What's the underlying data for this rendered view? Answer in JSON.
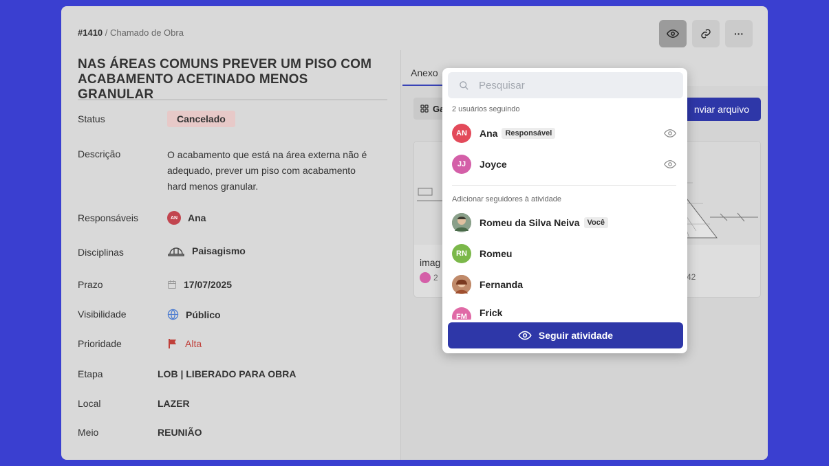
{
  "header": {
    "ticket_number": "#1410",
    "breadcrumb_rest": " / Chamado de Obra",
    "title": "NAS ÁREAS COMUNS PREVER UM PISO COM ACABAMENTO ACETINADO MENOS GRANULAR",
    "more_label": "···"
  },
  "fields": {
    "status": {
      "label": "Status",
      "value": "Cancelado"
    },
    "description": {
      "label": "Descrição",
      "value": "O acabamento que está na área externa não é adequado, prever um piso com acabamento hard menos granular."
    },
    "responsibles": {
      "label": "Responsáveis",
      "value": "Ana",
      "avatar": "AN"
    },
    "disciplines": {
      "label": "Disciplinas",
      "value": "Paisagismo"
    },
    "deadline": {
      "label": "Prazo",
      "value": "17/07/2025"
    },
    "visibility": {
      "label": "Visibilidade",
      "value": "Público"
    },
    "priority": {
      "label": "Prioridade",
      "value": "Alta"
    },
    "stage": {
      "label": "Etapa",
      "value": "LOB | LIBERADO PARA OBRA"
    },
    "location": {
      "label": "Local",
      "value": "LAZER"
    },
    "medium": {
      "label": "Meio",
      "value": "REUNIÃO"
    }
  },
  "attachments": {
    "tab_label": "Anexo",
    "gallery_label": "Ga",
    "send_label": "nviar arquivo",
    "card_name": "imag",
    "card_meta_left": "2",
    "card_meta_right": "42"
  },
  "followers_popup": {
    "search_placeholder": "Pesquisar",
    "following_label": "2 usuários seguindo",
    "following": [
      {
        "initials": "AN",
        "name": "Ana",
        "tag": "Responsável",
        "color": "#e34a5a"
      },
      {
        "initials": "JJ",
        "name": "Joyce",
        "tag": "",
        "color": "#d45fa8"
      }
    ],
    "add_label": "Adicionar seguidores à atividade",
    "candidates": [
      {
        "initials": "",
        "name": "Romeu da Silva Neiva",
        "tag": "Você",
        "color": "#5b7a5a"
      },
      {
        "initials": "RN",
        "name": "Romeu",
        "tag": "",
        "color": "#7bb84a"
      },
      {
        "initials": "",
        "name": "Fernanda",
        "tag": "",
        "color": "#b0704a"
      },
      {
        "initials": "FM",
        "name": "Frick",
        "tag": "",
        "color": "#e06aa6"
      }
    ],
    "follow_button": "Seguir atividade"
  },
  "colors": {
    "primary": "#2e37a8",
    "background": "#3a3fd0",
    "danger": "#c0403a"
  }
}
